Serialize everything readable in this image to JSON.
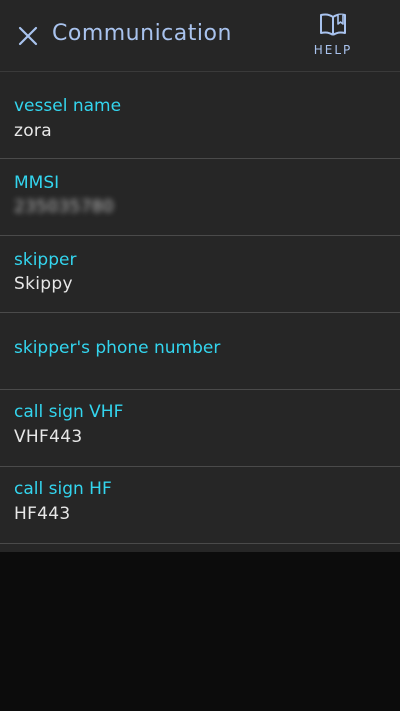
{
  "header": {
    "title": "Communication",
    "help_label": "HELP"
  },
  "fields": [
    {
      "label": "vessel name",
      "value": "zora"
    },
    {
      "label": "MMSI",
      "value": "235035780"
    },
    {
      "label": "skipper",
      "value": "Skippy"
    },
    {
      "label": "skipper's phone number",
      "value": ""
    },
    {
      "label": "call sign VHF",
      "value": "VHF443"
    },
    {
      "label": "call sign HF",
      "value": "HF443"
    }
  ],
  "colors": {
    "header_background": "#262626",
    "title_text": "#a9c3ee",
    "field_label": "#33d5ee",
    "field_value": "#e7e7e7",
    "divider": "#4a4a4a",
    "page_background": "#0c0c0c"
  },
  "icons": {
    "close": "close-icon",
    "help": "book-icon"
  }
}
